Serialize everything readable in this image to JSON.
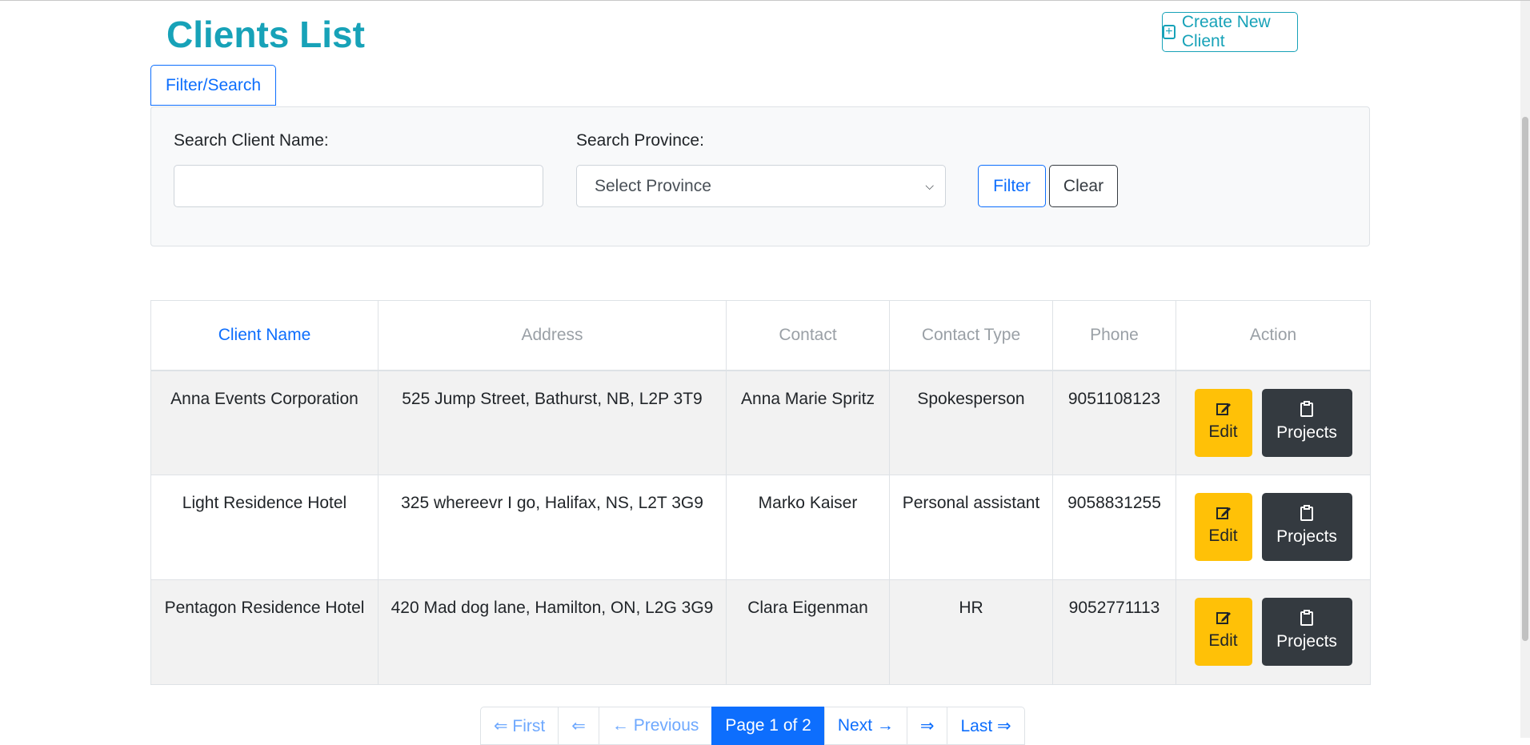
{
  "header": {
    "title": "Clients List",
    "create_button_label": "Create New Client",
    "create_icon": "plus-square-icon"
  },
  "filter": {
    "toggle_label": "Filter/Search",
    "client_name_label": "Search Client Name:",
    "client_name_value": "",
    "province_label": "Search Province:",
    "province_selected": "Select Province",
    "filter_button": "Filter",
    "clear_button": "Clear"
  },
  "table": {
    "columns": [
      "Client Name",
      "Address",
      "Contact",
      "Contact Type",
      "Phone",
      "Action"
    ],
    "rows": [
      {
        "name": "Anna Events Corporation",
        "address": "525 Jump Street, Bathurst, NB, L2P 3T9",
        "contact": "Anna Marie Spritz",
        "contact_type": "Spokesperson",
        "phone": "9051108123"
      },
      {
        "name": "Light Residence Hotel",
        "address": "325 whereevr I go, Halifax, NS, L2T 3G9",
        "contact": "Marko Kaiser",
        "contact_type": "Personal assistant",
        "phone": "9058831255"
      },
      {
        "name": "Pentagon Residence Hotel",
        "address": "420 Mad dog lane, Hamilton, ON, L2G 3G9",
        "contact": "Clara Eigenman",
        "contact_type": "HR",
        "phone": "9052771113"
      }
    ],
    "edit_label": "Edit",
    "projects_label": "Projects",
    "edit_icon": "edit-icon",
    "projects_icon": "clipboard-icon"
  },
  "pagination": {
    "first": "⇐ First",
    "prev_arrow": "⇐",
    "previous": "← Previous",
    "current": "Page 1 of 2",
    "next": "Next →",
    "next_arrow": "⇒",
    "last": "Last ⇒"
  },
  "colors": {
    "title": "#17a2b8",
    "primary": "#0d6efd",
    "warning": "#ffc107",
    "dark": "#343a40"
  }
}
